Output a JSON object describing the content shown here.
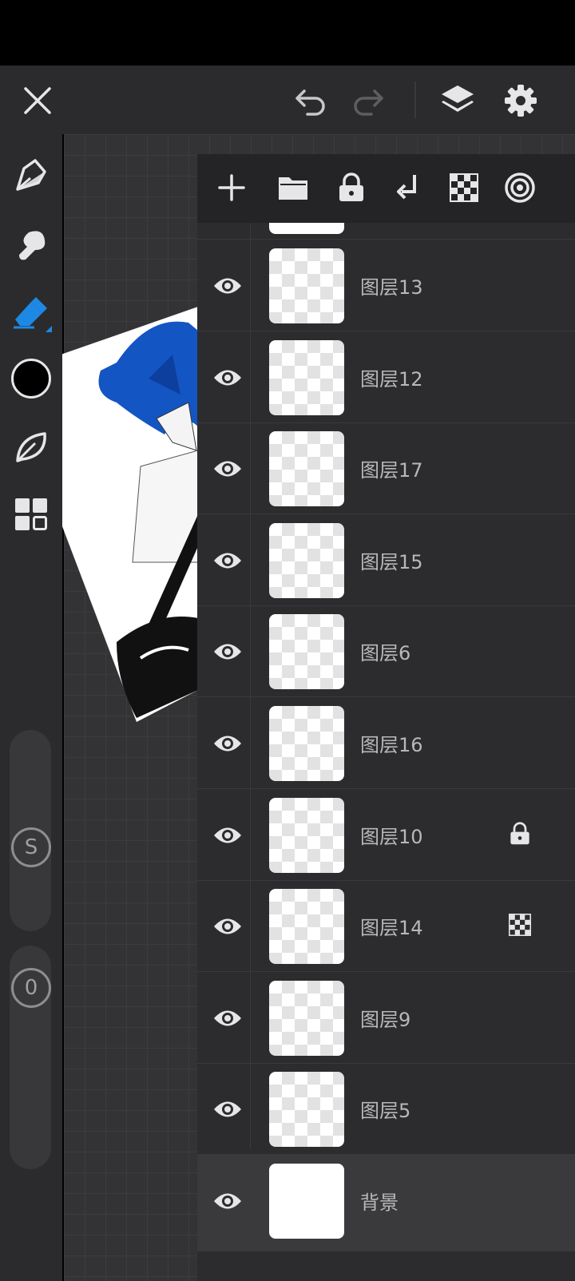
{
  "app": {
    "name": "drawing-app"
  },
  "topbar": {
    "close_icon": "close-icon",
    "undo_icon": "undo-icon",
    "redo_icon": "redo-icon",
    "layers_icon": "layers-icon",
    "settings_icon": "gear-icon"
  },
  "tools": [
    {
      "name": "pen-tool",
      "icon": "pen-icon",
      "active": false
    },
    {
      "name": "smudge-tool",
      "icon": "smudge-icon",
      "active": false
    },
    {
      "name": "eraser-tool",
      "icon": "eraser-icon",
      "active": true
    },
    {
      "name": "color-swatch",
      "icon": "color-circle-icon",
      "color": "#000000"
    },
    {
      "name": "brush-library",
      "icon": "leaf-icon",
      "active": false
    },
    {
      "name": "more-tools",
      "icon": "grid-icon",
      "active": false
    }
  ],
  "sliders": {
    "size_label": "S",
    "opacity_label": "0"
  },
  "layers_toolbar": {
    "icons": [
      "add-layer-icon",
      "folder-icon",
      "lock-icon",
      "merge-down-icon",
      "checkerboard-icon",
      "target-icon"
    ]
  },
  "layers": [
    {
      "name": "图层13",
      "visible": true,
      "badge": ""
    },
    {
      "name": "图层12",
      "visible": true,
      "badge": ""
    },
    {
      "name": "图层17",
      "visible": true,
      "badge": ""
    },
    {
      "name": "图层15",
      "visible": true,
      "badge": ""
    },
    {
      "name": "图层6",
      "visible": true,
      "badge": ""
    },
    {
      "name": "图层16",
      "visible": true,
      "badge": ""
    },
    {
      "name": "图层10",
      "visible": true,
      "badge": "lock-icon"
    },
    {
      "name": "图层14",
      "visible": true,
      "badge": "checkerboard-icon"
    },
    {
      "name": "图层9",
      "visible": true,
      "badge": ""
    },
    {
      "name": "图层5",
      "visible": true,
      "badge": ""
    },
    {
      "name": "背景",
      "visible": true,
      "badge": "",
      "selected": true
    }
  ],
  "colors": {
    "accent": "#1e88e5",
    "panel_bg": "#2c2c2e",
    "topbar_bg": "#2b2b2d",
    "icon_color": "#e6e6e8",
    "text_color": "#b8b8bc"
  }
}
